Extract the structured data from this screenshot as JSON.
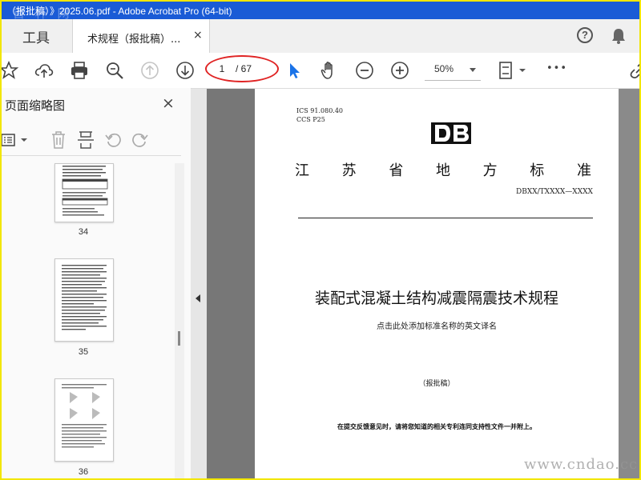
{
  "window": {
    "title": "（报批稿）》2025.06.pdf - Adobe Acrobat Pro (64-bit)",
    "watermark_top": "首 杯 网"
  },
  "tabs": {
    "tools_label": "工具",
    "document_label": "术规程（报批稿）...",
    "close_glyph": "×",
    "help_glyph": "?"
  },
  "toolbar": {
    "page_current": "1",
    "page_total": "/ 67",
    "zoom": "50%",
    "more_glyph": "•••"
  },
  "sidepanel": {
    "title": "页面缩略图",
    "close_glyph": "×",
    "thumbnails": [
      {
        "page": "34"
      },
      {
        "page": "35"
      },
      {
        "page": "36"
      }
    ]
  },
  "page": {
    "ics": "ICS  91.080.40",
    "ccs": "CCS  P25",
    "db_logo": "DB",
    "province_chars": [
      "江",
      "苏",
      "省",
      "地",
      "方",
      "标",
      "准"
    ],
    "code": "DBXX/TXXXX—XXXX",
    "title": "装配式混凝土结构减震隔震技术规程",
    "subtitle": "点击此处添加标准名称的英文译名",
    "draft": "（报批稿）",
    "note": "在提交反馈意见时，请将您知道的相关专利连同支持性文件一并附上。"
  },
  "watermark": "www.cndao.cc",
  "colors": {
    "title_bar": "#1a5bd6",
    "highlight_oval": "#e02424",
    "frame_border": "#f2e600",
    "select_tool": "#1a73e8"
  },
  "icons": [
    "star-icon",
    "upload-icon",
    "print-icon",
    "zoom-search-icon",
    "page-up-icon",
    "page-down-icon",
    "select-cursor-icon",
    "hand-icon",
    "zoom-out-icon",
    "zoom-in-icon",
    "fit-page-icon",
    "more-icon",
    "link-icon"
  ]
}
